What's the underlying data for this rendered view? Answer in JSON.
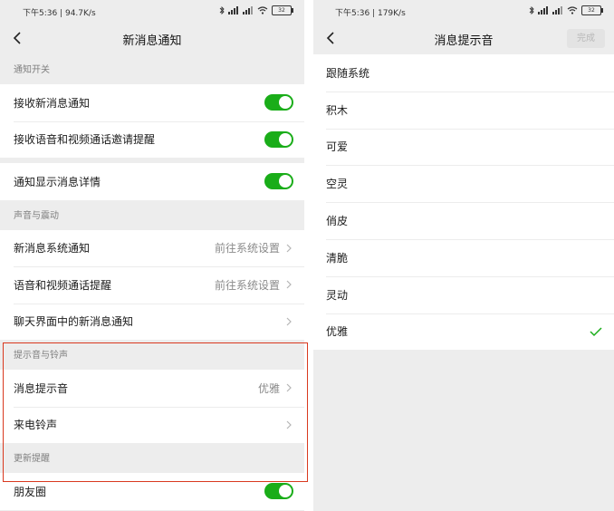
{
  "left": {
    "statusbar": "下午5:36 | 94.7K/s",
    "battery": "32",
    "title": "新消息通知",
    "sections": [
      {
        "header": "通知开关",
        "groups": [
          {
            "rows": [
              {
                "label": "接收新消息通知",
                "type": "toggle",
                "on": true
              },
              {
                "label": "接收语音和视频通话邀请提醒",
                "type": "toggle",
                "on": true
              }
            ]
          },
          {
            "rows": [
              {
                "label": "通知显示消息详情",
                "type": "toggle",
                "on": true
              }
            ]
          }
        ]
      },
      {
        "header": "声音与震动",
        "groups": [
          {
            "rows": [
              {
                "label": "新消息系统通知",
                "type": "link",
                "value": "前往系统设置"
              },
              {
                "label": "语音和视频通话提醒",
                "type": "link",
                "value": "前往系统设置"
              },
              {
                "label": "聊天界面中的新消息通知",
                "type": "link",
                "value": ""
              }
            ]
          }
        ]
      },
      {
        "header": "提示音与铃声",
        "groups": [
          {
            "rows": [
              {
                "label": "消息提示音",
                "type": "link",
                "value": "优雅"
              },
              {
                "label": "来电铃声",
                "type": "link",
                "value": ""
              }
            ]
          }
        ]
      },
      {
        "header": "更新提醒",
        "groups": [
          {
            "rows": [
              {
                "label": "朋友圈",
                "type": "toggle",
                "on": true
              }
            ]
          }
        ]
      }
    ]
  },
  "right": {
    "statusbar": "下午5:36 | 179K/s",
    "battery": "32",
    "title": "消息提示音",
    "done_label": "完成",
    "options": [
      {
        "label": "跟随系统",
        "selected": false
      },
      {
        "label": "积木",
        "selected": false
      },
      {
        "label": "可爱",
        "selected": false
      },
      {
        "label": "空灵",
        "selected": false
      },
      {
        "label": "俏皮",
        "selected": false
      },
      {
        "label": "清脆",
        "selected": false
      },
      {
        "label": "灵动",
        "selected": false
      },
      {
        "label": "优雅",
        "selected": true
      }
    ]
  },
  "colors": {
    "accent": "#1aad19",
    "highlight": "#d9391f",
    "background": "#ededed"
  }
}
